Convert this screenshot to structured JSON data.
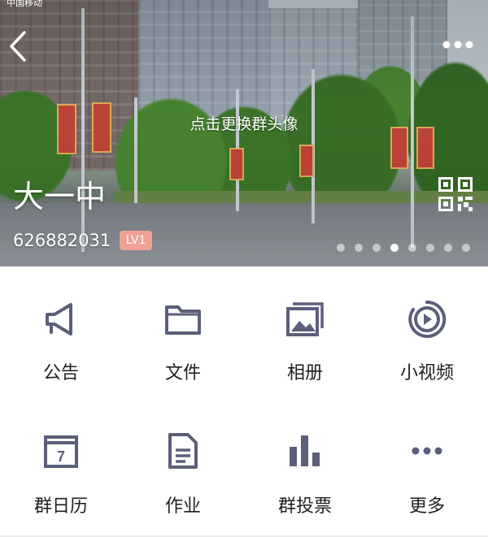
{
  "status_bar": {
    "carrier": "中国移动"
  },
  "header": {
    "change_avatar_hint": "点击更换群头像",
    "group_name": "大一中",
    "group_id": "626882031",
    "level": "LV1",
    "carousel": {
      "count": 8,
      "active_index": 3
    }
  },
  "icons": {
    "back": "chevron-left-icon",
    "more": "more-dots-icon",
    "qr": "qr-code-icon"
  },
  "colors": {
    "icon": "#5b5f7a",
    "badge": "#f0a195",
    "text": "#1f1f1f"
  },
  "menu": [
    {
      "label": "公告",
      "icon": "megaphone-icon"
    },
    {
      "label": "文件",
      "icon": "folder-icon"
    },
    {
      "label": "相册",
      "icon": "photo-album-icon"
    },
    {
      "label": "小视频",
      "icon": "video-play-icon"
    },
    {
      "label": "群日历",
      "icon": "calendar-icon"
    },
    {
      "label": "作业",
      "icon": "document-icon"
    },
    {
      "label": "群投票",
      "icon": "bar-chart-icon"
    },
    {
      "label": "更多",
      "icon": "more-horizontal-icon"
    }
  ]
}
